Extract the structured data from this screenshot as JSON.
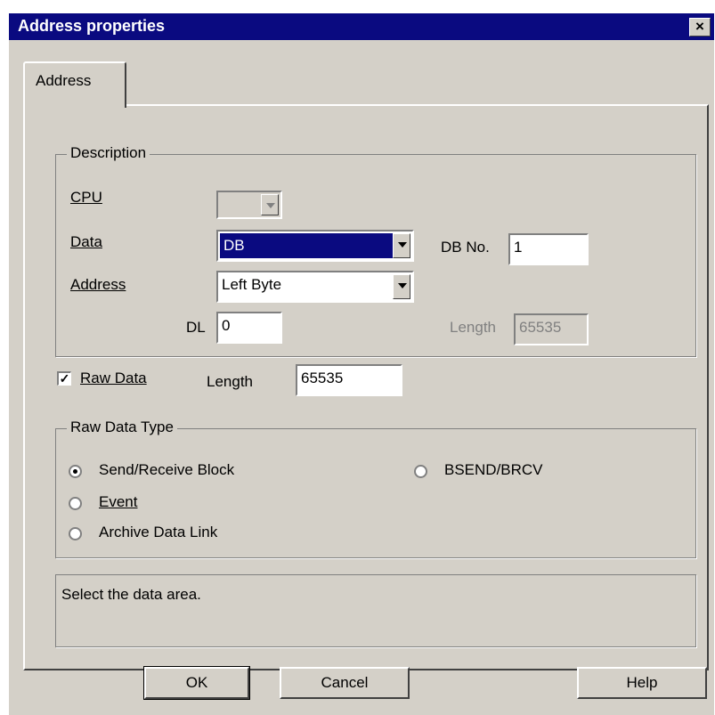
{
  "window": {
    "title": "Address properties",
    "close_glyph": "×"
  },
  "tabs": [
    {
      "label": "Address"
    }
  ],
  "description": {
    "legend": "Description",
    "cpu_label": "CPU",
    "cpu_value": "",
    "data_label": "Data",
    "data_value": "DB",
    "db_no_label": "DB No.",
    "db_no_value": "1",
    "address_label": "Address",
    "address_value": "Left Byte",
    "dl_label": "DL",
    "dl_value": "0",
    "length_label": "Length",
    "length_value": "65535"
  },
  "raw_data": {
    "checked": true,
    "label": "Raw Data",
    "length_label": "Length",
    "length_value": "65535"
  },
  "raw_data_type": {
    "legend": "Raw Data Type",
    "options": [
      {
        "label": "Send/Receive Block",
        "selected": true
      },
      {
        "label": "BSEND/BRCV",
        "selected": false
      },
      {
        "label": "Event",
        "selected": false
      },
      {
        "label": "Archive Data Link",
        "selected": false
      }
    ]
  },
  "hint": "Select the data area.",
  "buttons": {
    "ok": "OK",
    "cancel": "Cancel",
    "help": "Help"
  }
}
